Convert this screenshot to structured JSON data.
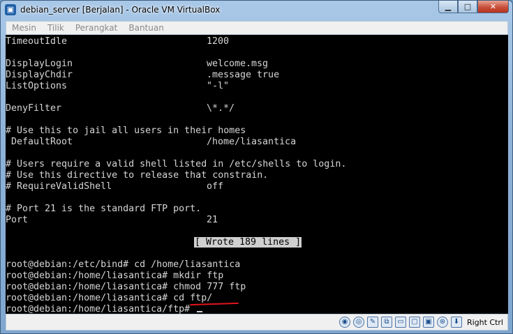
{
  "window": {
    "title": "debian_server [Berjalan] - Oracle VM VirtualBox"
  },
  "menu": [
    "Mesin",
    "Tilik",
    "Perangkat",
    "Bantuan"
  ],
  "terminal": {
    "lines": [
      {
        "row": 0,
        "a": "TimeoutIdle",
        "b": "1200"
      },
      {
        "row": 2,
        "a": "DisplayLogin",
        "b": "welcome.msg"
      },
      {
        "row": 3,
        "a": "DisplayChdir",
        "b": ".message true"
      },
      {
        "row": 4,
        "a": "ListOptions",
        "b": "\"-l\""
      },
      {
        "row": 6,
        "a": "DenyFilter",
        "b": "\\*.*/"
      },
      {
        "row": 8,
        "a": "# Use this to jail all users in their homes",
        "b": ""
      },
      {
        "row": 9,
        "a": " DefaultRoot",
        "b": "/home/liasantica"
      },
      {
        "row": 11,
        "a": "# Users require a valid shell listed in /etc/shells to login.",
        "b": ""
      },
      {
        "row": 12,
        "a": "# Use this directive to release that constrain.",
        "b": ""
      },
      {
        "row": 13,
        "a": "# RequireValidShell",
        "b": "off"
      },
      {
        "row": 15,
        "a": "# Port 21 is the standard FTP port.",
        "b": ""
      },
      {
        "row": 16,
        "a": "Port",
        "b": "21"
      },
      {
        "row": 20,
        "a": "root@debian:/etc/bind# cd /home/liasantica",
        "b": ""
      },
      {
        "row": 21,
        "a": "root@debian:/home/liasantica# mkdir ftp",
        "b": ""
      },
      {
        "row": 22,
        "a": "root@debian:/home/liasantica# chmod 777 ftp",
        "b": ""
      },
      {
        "row": 23,
        "a": "root@debian:/home/liasantica# cd ftp/",
        "b": ""
      },
      {
        "row": 24,
        "a": "root@debian:/home/liasantica/ftp# ",
        "b": ""
      }
    ],
    "banner": "[ Wrote 189 lines ]"
  },
  "status": {
    "host_key": "Right Ctrl"
  },
  "colors": {
    "terminal_bg": "#000000",
    "terminal_fg": "#d6d6d6",
    "annotation": "#e0141d"
  }
}
